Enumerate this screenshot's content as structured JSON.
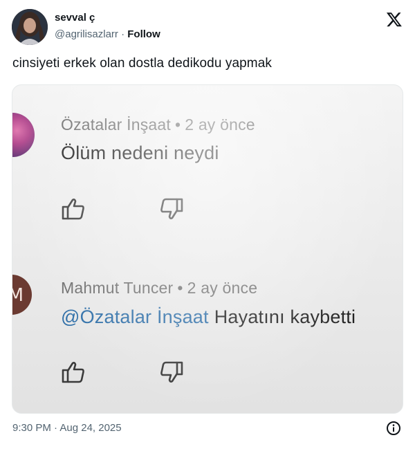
{
  "author": {
    "display_name": "sevval ç",
    "handle": "@agrilisazlarr",
    "separator": "·",
    "follow_label": "Follow"
  },
  "tweet": {
    "text": "cinsiyeti erkek olan dostla dedikodu yapmak",
    "timestamp": "9:30 PM · Aug 24, 2025"
  },
  "comments": [
    {
      "author": "Özatalar İnşaat",
      "time": "2 ay önce",
      "mention": "",
      "text": "Ölüm nedeni neydi"
    },
    {
      "author": "Mahmut Tuncer",
      "avatar_letter": "M",
      "time": "2 ay önce",
      "mention": "@Özatalar İnşaat",
      "text": "Hayatını kaybetti"
    }
  ],
  "icons": {
    "brand": "x-logo-icon",
    "info": "info-icon",
    "like": "thumbs-up-icon",
    "dislike": "thumbs-down-icon"
  },
  "colors": {
    "text": "#0f1419",
    "secondary": "#536471",
    "mention": "#2f6fa8"
  }
}
